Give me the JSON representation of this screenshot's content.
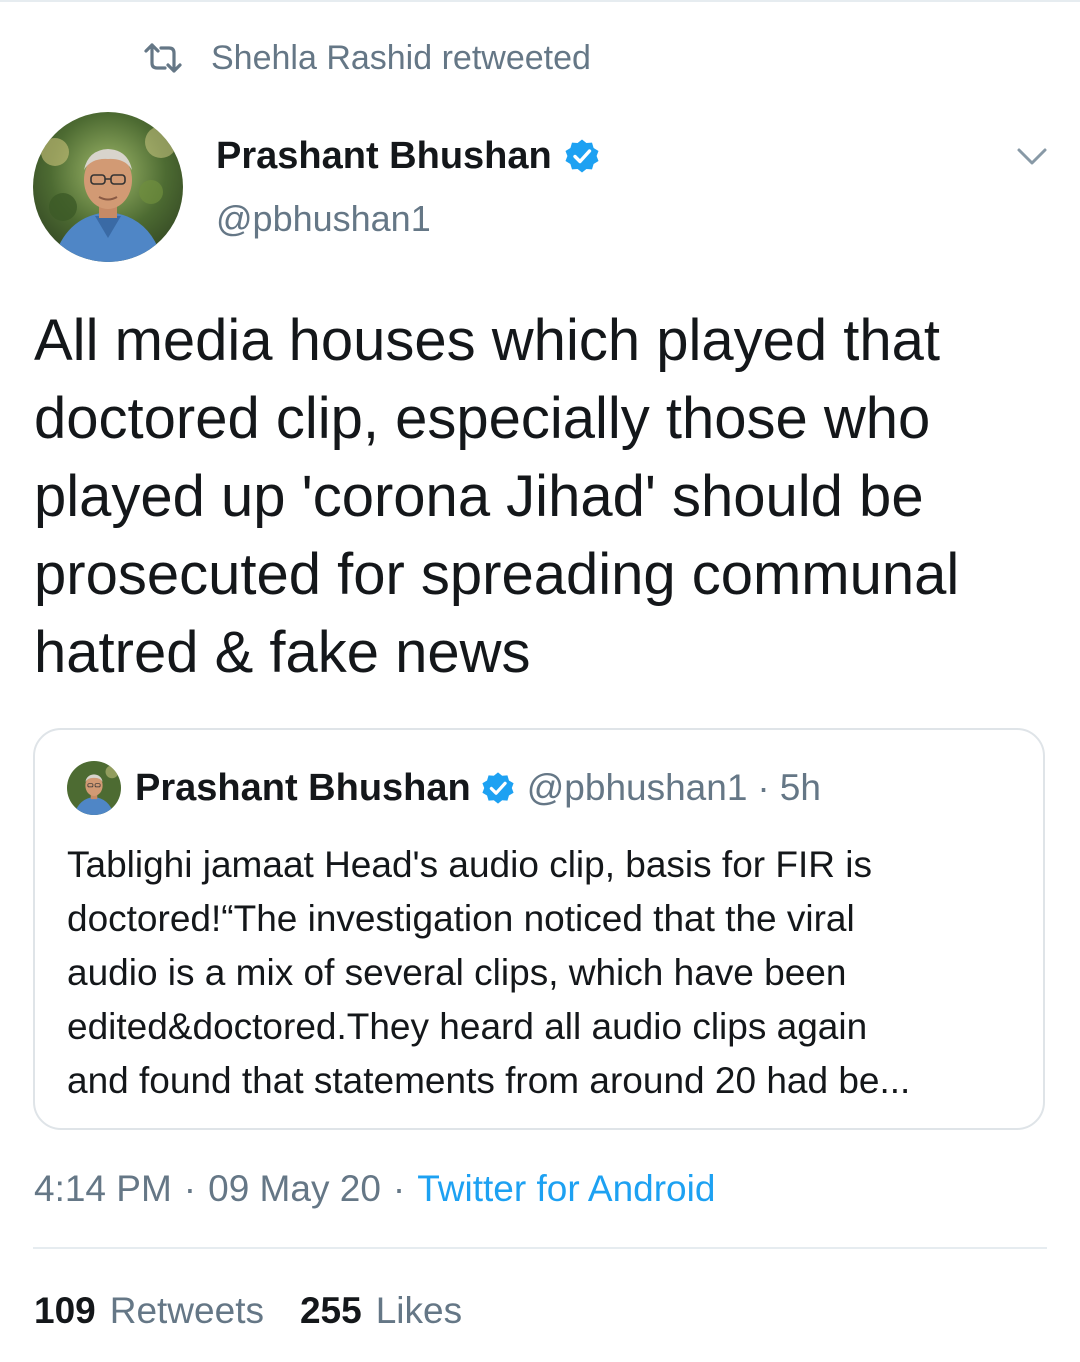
{
  "retweet": {
    "icon": "retweet-icon",
    "text": "Shehla Rashid retweeted"
  },
  "tweet": {
    "author_name": "Prashant Bhushan",
    "author_handle": "@pbhushan1",
    "verified": true,
    "text": "All media houses which played that\ndoctored clip, especially those who\nplayed up 'corona Jihad' should be\nprosecuted for spreading communal\nhatred & fake news"
  },
  "quoted_tweet": {
    "author_name": "Prashant Bhushan",
    "author_handle": "@pbhushan1",
    "separator": "·",
    "time": "5h",
    "verified": true,
    "text": "Tablighi jamaat Head's audio clip, basis for FIR is\ndoctored!“The investigation noticed that the viral\naudio is a mix of several clips, which have been\nedited&doctored.They heard all audio clips again\nand found that statements from around 20 had be..."
  },
  "meta": {
    "time": "4:14 PM",
    "separator": "·",
    "date": "09 May 20",
    "source": "Twitter for Android"
  },
  "stats": {
    "retweets_count": "109",
    "retweets_label": "Retweets",
    "likes_count": "255",
    "likes_label": "Likes"
  },
  "colors": {
    "accent": "#1da1f2",
    "muted_text": "#657786",
    "primary_text": "#14171a",
    "border": "#e6ecf0"
  },
  "icons": [
    "retweet-icon",
    "verified-badge-icon",
    "chevron-down-icon",
    "avatar"
  ]
}
